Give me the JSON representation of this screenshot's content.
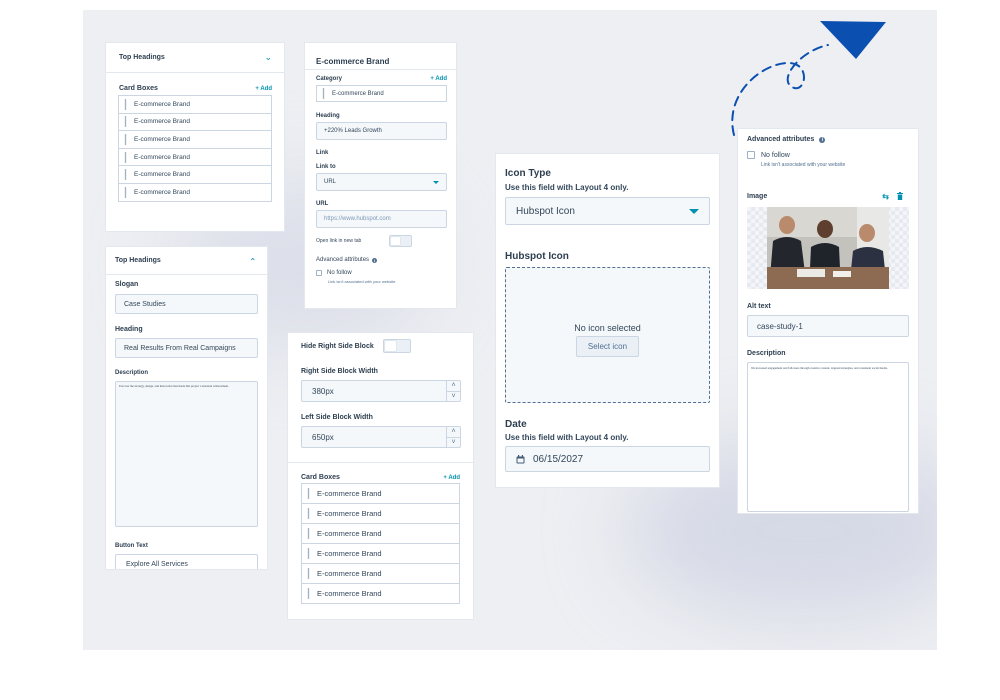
{
  "colors": {
    "accent": "#0091ae",
    "arrow": "#0b4fb0",
    "text": "#33475b",
    "border": "#cbd6e2"
  },
  "p1": {
    "title": "Top Headings",
    "card_boxes_label": "Card Boxes",
    "add_label": "+ Add",
    "items": [
      "E-commerce Brand",
      "E-commerce Brand",
      "E-commerce Brand",
      "E-commerce Brand",
      "E-commerce Brand",
      "E-commerce Brand"
    ]
  },
  "p2": {
    "title": "Top Headings",
    "slogan_label": "Slogan",
    "slogan_value": "Case Studies",
    "heading_label": "Heading",
    "heading_value": "Real Results From Real Campaigns",
    "description_label": "Description",
    "description_value": "Uncover the strategy, design, and innovation that made this project a standout achievement.",
    "button_text_label": "Button Text",
    "button_text_value": "Explore All Services"
  },
  "p3": {
    "title": "E-commerce Brand",
    "category_label": "Category",
    "add_label": "+ Add",
    "category_value": "E-commerce Brand",
    "heading_label": "Heading",
    "heading_value": "+220% Leads Growth",
    "link_label": "Link",
    "link_to_label": "Link to",
    "link_to_value": "URL",
    "url_label": "URL",
    "url_value": "https://www.hubspot.com",
    "new_tab_label": "Open link in new tab",
    "advanced_label": "Advanced attributes",
    "nofollow_label": "No follow",
    "nofollow_hint": "Link isn't associated with your website"
  },
  "p4": {
    "hide_label": "Hide Right Side Block",
    "right_width_label": "Right Side Block Width",
    "right_width_value": "380px",
    "left_width_label": "Left Side Block Width",
    "left_width_value": "650px",
    "card_boxes_label": "Card Boxes",
    "add_label": "+ Add",
    "items": [
      "E-commerce Brand",
      "E-commerce Brand",
      "E-commerce Brand",
      "E-commerce Brand",
      "E-commerce Brand",
      "E-commerce Brand"
    ]
  },
  "p5": {
    "icon_type_label": "Icon Type",
    "icon_type_hint": "Use this field with Layout 4 only.",
    "icon_type_value": "Hubspot Icon",
    "hubspot_icon_label": "Hubspot Icon",
    "no_icon_text": "No icon selected",
    "select_icon_label": "Select icon",
    "date_label": "Date",
    "date_hint": "Use this field with Layout 4 only.",
    "date_value": "06/15/2027"
  },
  "p6": {
    "advanced_label": "Advanced attributes",
    "nofollow_label": "No follow",
    "nofollow_hint": "Link isn't associated with your website",
    "image_label": "Image",
    "alt_label": "Alt text",
    "alt_value": "case-study-1",
    "description_label": "Description",
    "description_value": "We increased engagement and followers through creative content, targeted strategies, and consistent social media."
  },
  "icons": [
    "chevron-down-icon",
    "chevron-up-icon",
    "drag-handle-icon",
    "caret-down-icon",
    "info-icon",
    "calendar-icon",
    "swap-icon",
    "trash-icon",
    "arrow-icon"
  ]
}
